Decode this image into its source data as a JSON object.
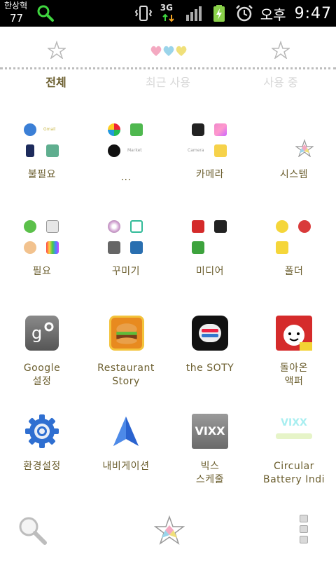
{
  "status_bar": {
    "carrier_line1": "한상혁",
    "carrier_line2": "77",
    "network": "3G",
    "ampm": "오후",
    "time": "9:47"
  },
  "tabs": [
    {
      "label": "전체",
      "selected": true
    },
    {
      "label": "최근 사용",
      "selected": false
    },
    {
      "label": "사용 중",
      "selected": false
    }
  ],
  "folders": [
    {
      "label": "불필요",
      "mini": [
        "Gmail"
      ]
    },
    {
      "label": "...",
      "mini": [
        "Market"
      ]
    },
    {
      "label": "카메라",
      "mini": [
        "Camera"
      ]
    },
    {
      "label": "시스템",
      "mini": []
    },
    {
      "label": "필요",
      "mini": []
    },
    {
      "label": "꾸미기",
      "mini": []
    },
    {
      "label": "미디어",
      "mini": []
    },
    {
      "label": "폴더",
      "mini": []
    }
  ],
  "apps": [
    {
      "label_line1": "Google",
      "label_line2": "설정",
      "icon": "google-settings-icon"
    },
    {
      "label_line1": "Restaurant",
      "label_line2": "Story",
      "icon": "restaurant-story-icon"
    },
    {
      "label_line1": "the SOTY",
      "label_line2": "",
      "icon": "soty-icon"
    },
    {
      "label_line1": "돌아온",
      "label_line2": "액퍼",
      "icon": "dolaon-app-icon"
    },
    {
      "label_line1": "환경설정",
      "label_line2": "",
      "icon": "settings-gear-icon"
    },
    {
      "label_line1": "내비게이션",
      "label_line2": "",
      "icon": "navigation-arrow-icon"
    },
    {
      "label_line1": "빅스",
      "label_line2": "스케줄",
      "icon": "vixx-icon",
      "icon_text": "VIXX"
    },
    {
      "label_line1": "Circular",
      "label_line2": "Battery Indi",
      "icon": "vixx-battery-icon",
      "icon_text": "VIXX"
    }
  ],
  "colors": {
    "label": "#6b5e2e",
    "tab_inactive": "#d8d8d8",
    "status_bg": "#000000"
  }
}
